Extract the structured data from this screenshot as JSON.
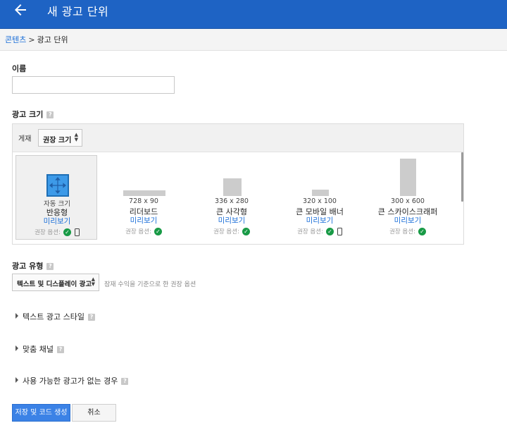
{
  "header": {
    "title": "새 광고 단위"
  },
  "breadcrumb": {
    "parent": "콘텐츠",
    "separator": ">",
    "current": "광고 단위"
  },
  "name_section": {
    "label": "이름",
    "value": "",
    "placeholder": ""
  },
  "size_section": {
    "label": "광고 크기",
    "display_label": "게재",
    "display_select": "권장 크기",
    "cards": [
      {
        "dims": "자동 크기",
        "name": "반응형",
        "preview": "미리보기",
        "recommended": "권장 옵션:",
        "mobile": true
      },
      {
        "dims": "728 x 90",
        "name": "리더보드",
        "preview": "미리보기",
        "recommended": "권장 옵션:",
        "mobile": false
      },
      {
        "dims": "336 x 280",
        "name": "큰 사각형",
        "preview": "미리보기",
        "recommended": "권장 옵션:",
        "mobile": false
      },
      {
        "dims": "320 x 100",
        "name": "큰 모바일 배너",
        "preview": "미리보기",
        "recommended": "권장 옵션:",
        "mobile": true
      },
      {
        "dims": "300 x 600",
        "name": "큰 스카이스크래퍼",
        "preview": "미리보기",
        "recommended": "권장 옵션:",
        "mobile": false
      }
    ]
  },
  "type_section": {
    "label": "광고 유형",
    "select_value": "텍스트 및 디스플레이 광고",
    "note": "잠재 수익을 기준으로 한 권장 옵션"
  },
  "expanders": [
    "텍스트 광고 스타일",
    "맞춤 채널",
    "사용 가능한 광고가 없는 경우"
  ],
  "actions": {
    "save": "저장 및 코드 생성",
    "cancel": "취소"
  },
  "colors": {
    "header": "#1e63c4",
    "link": "#1a6ed8",
    "check": "#189a46",
    "primary_button": "#3b82e6"
  },
  "icons": {
    "back": "arrow-left-icon",
    "help": "help-icon",
    "check": "check-circle-icon",
    "mobile": "mobile-phone-icon",
    "responsive": "resize-arrows-icon",
    "expand": "triangle-right-icon"
  }
}
